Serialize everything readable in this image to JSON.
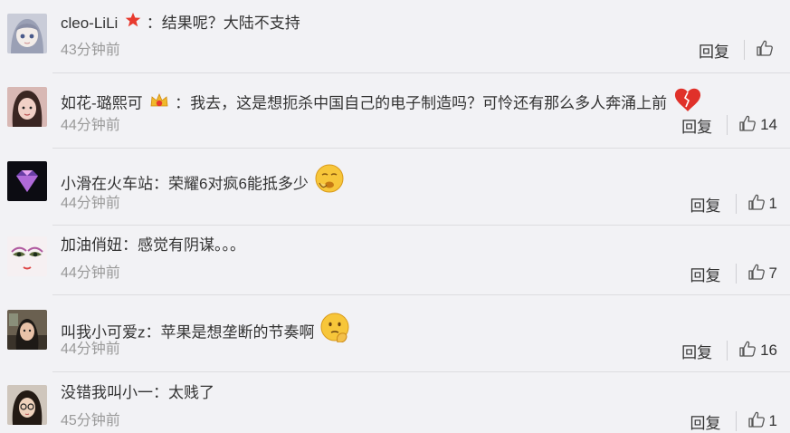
{
  "comments": [
    {
      "user": "cleo-LiLi",
      "badge": "star-badge-icon",
      "colon": "：",
      "text": "结果呢？大陆不支持",
      "time": "43分钟前",
      "reply": "回复",
      "likes": ""
    },
    {
      "user": "如花-璐熙可",
      "badge": "vip-crown-icon",
      "colon": "：",
      "text": "我去，这是想扼杀中国自己的电子制造吗？可怜还有那么多人奔涌上前",
      "emoji": "broken-heart-emoji",
      "time": "44分钟前",
      "reply": "回复",
      "likes": "14"
    },
    {
      "user": "小滑在火车站",
      "colon": "：",
      "text": "荣耀6对疯6能抵多少",
      "emoji": "sick-face-emoji",
      "time": "44分钟前",
      "reply": "回复",
      "likes": "1"
    },
    {
      "user": "加油俏妞",
      "colon": "：",
      "text": "感觉有阴谋。。。",
      "time": "44分钟前",
      "reply": "回复",
      "likes": "7"
    },
    {
      "user": "叫我小可爱z",
      "colon": "：",
      "text": "苹果是想垄断的节奏啊",
      "emoji": "thinking-face-emoji",
      "time": "44分钟前",
      "reply": "回复",
      "likes": "16"
    },
    {
      "user": "没错我叫小一",
      "colon": "：",
      "text": "太贱了",
      "time": "45分钟前",
      "reply": "回复",
      "likes": "1"
    }
  ],
  "colors": {
    "background": "#f2f2f5",
    "text": "#333333",
    "time": "#9a9a9a",
    "badge_red": "#e83a2e",
    "heart_red": "#e0312a",
    "emoji_yellow": "#f7c63a"
  }
}
